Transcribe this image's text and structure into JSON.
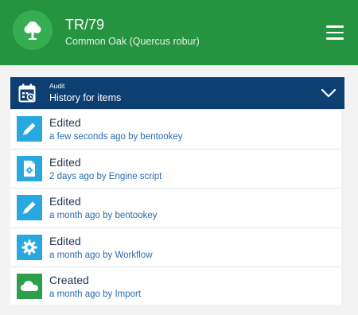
{
  "header": {
    "id_title": "TR/79",
    "subtitle": "Common Oak (Quercus robur)",
    "avatar_icon": "tree-icon",
    "menu_icon": "hamburger-menu-icon",
    "color": "#25933f"
  },
  "panel": {
    "kicker": "Audit",
    "title": "History for items",
    "icon": "calendar-history-icon",
    "chevron_icon": "chevron-down-icon",
    "color": "#0e3f73"
  },
  "history": [
    {
      "action": "Edited",
      "meta": "a few seconds ago by bentookey",
      "icon": "pencil-icon",
      "icon_color": "#29a8e0"
    },
    {
      "action": "Edited",
      "meta": "2 days ago by Engine script",
      "icon": "script-file-icon",
      "icon_color": "#29a8e0"
    },
    {
      "action": "Edited",
      "meta": "a month ago by bentookey",
      "icon": "pencil-icon",
      "icon_color": "#29a8e0"
    },
    {
      "action": "Edited",
      "meta": "a month ago by Workflow",
      "icon": "gear-icon",
      "icon_color": "#29a8e0"
    },
    {
      "action": "Created",
      "meta": "a month ago by Import",
      "icon": "cloud-icon",
      "icon_color": "#2e9e4a"
    }
  ]
}
